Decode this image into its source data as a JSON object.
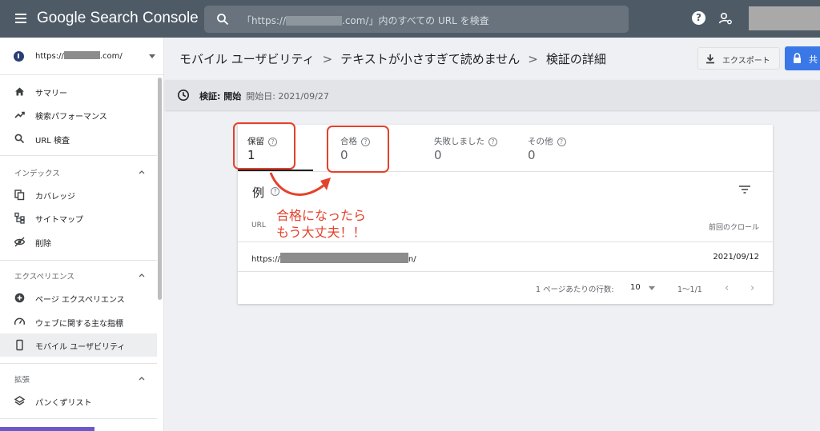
{
  "app": {
    "title": "Google Search Console"
  },
  "search": {
    "placeholder_before": "「https://",
    "placeholder_after": ".com/」内のすべての URL を検査"
  },
  "property": {
    "prefix": "https://",
    "suffix": ".com/"
  },
  "sidebar": {
    "top_items": [
      {
        "label": "サマリー",
        "icon": "home-icon"
      },
      {
        "label": "検索パフォーマンス",
        "icon": "trending-icon"
      },
      {
        "label": "URL 検査",
        "icon": "search-icon"
      }
    ],
    "sections": [
      {
        "title": "インデックス",
        "items": [
          {
            "label": "カバレッジ",
            "icon": "copy-icon"
          },
          {
            "label": "サイトマップ",
            "icon": "sitemap-icon"
          },
          {
            "label": "削除",
            "icon": "eye-off-icon"
          }
        ]
      },
      {
        "title": "エクスペリエンス",
        "items": [
          {
            "label": "ページ エクスペリエンス",
            "icon": "plus-circle-icon"
          },
          {
            "label": "ウェブに関する主な指標",
            "icon": "gauge-icon"
          },
          {
            "label": "モバイル ユーザビリティ",
            "icon": "phone-icon",
            "active": true
          }
        ]
      },
      {
        "title": "拡張",
        "items": [
          {
            "label": "パンくずリスト",
            "icon": "layers-icon"
          }
        ]
      }
    ]
  },
  "breadcrumb": {
    "level1": "モバイル ユーザビリティ",
    "level2": "テキストが小さすぎて読めません",
    "level3": "検証の詳細",
    "sep": ">"
  },
  "toolbar": {
    "export_label": "エクスポート",
    "share_label": "共"
  },
  "status": {
    "label": "検証: 開始",
    "started": "開始日: 2021/09/27"
  },
  "metrics": [
    {
      "label": "保留",
      "value": "1"
    },
    {
      "label": "合格",
      "value": "0"
    },
    {
      "label": "失敗しました",
      "value": "0"
    },
    {
      "label": "その他",
      "value": "0"
    }
  ],
  "examples": {
    "title": "例",
    "columns": {
      "url": "URL",
      "crawl": "前回のクロール"
    },
    "rows": [
      {
        "url_prefix": "https://",
        "url_suffix": "n/",
        "date": "2021/09/12"
      }
    ]
  },
  "pagination": {
    "rows_label": "1 ページあたりの行数:",
    "rows_value": "10",
    "range": "1〜1/1",
    "prev": "‹",
    "next": "›"
  },
  "annotation": {
    "line1": "合格になったら",
    "line2": "もう大丈夫！！",
    "color": "#e5412b"
  },
  "help_glyph": "?",
  "q_glyph": "?"
}
